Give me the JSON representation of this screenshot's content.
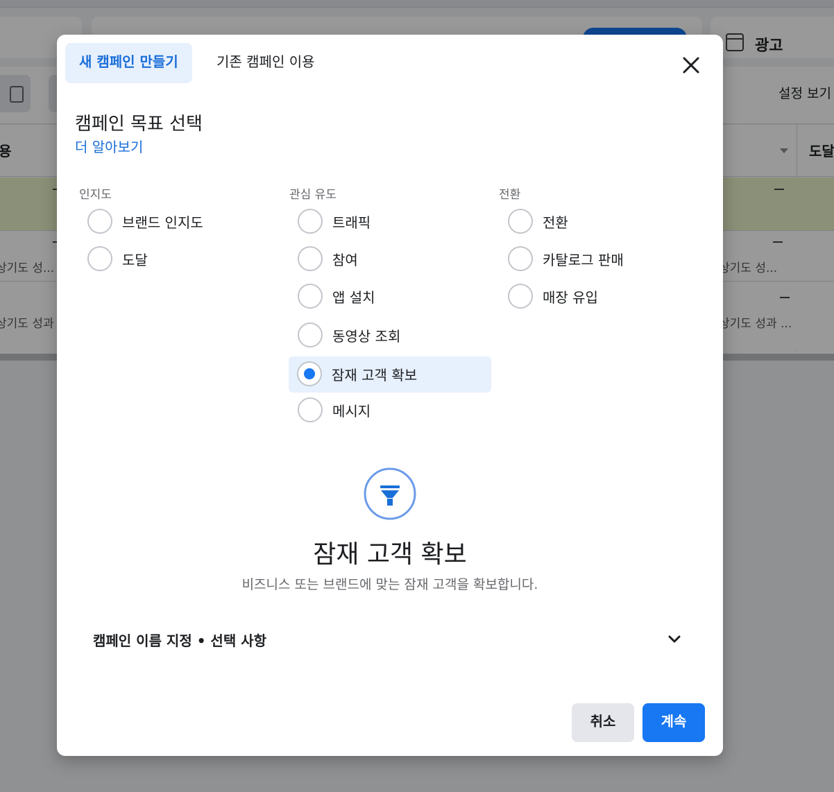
{
  "background": {
    "ad_label": "광고",
    "settings_label": "설정 보기",
    "col_header_left": "용",
    "col_header_right": "도달",
    "row2_left_text": "상기도 성...",
    "row3_left_text": "상기도 성과",
    "row2_right_text": "상기도 성...",
    "row3_right_text": "상기도 성과 ..."
  },
  "modal": {
    "tabs": [
      {
        "label": "새 캠페인 만들기",
        "active": true
      },
      {
        "label": "기존 캠페인 이용",
        "active": false
      }
    ],
    "close_icon": "close-icon",
    "section_title": "캠페인 목표 선택",
    "learn_more": "더 알아보기",
    "columns": [
      {
        "heading": "인지도",
        "options": [
          "브랜드 인지도",
          "도달"
        ]
      },
      {
        "heading": "관심 유도",
        "options": [
          "트래픽",
          "참여",
          "앱 설치",
          "동영상 조회",
          "잠재 고객 확보",
          "메시지"
        ]
      },
      {
        "heading": "전환",
        "options": [
          "전환",
          "카탈로그 판매",
          "매장 유입"
        ]
      }
    ],
    "selected_option": "잠재 고객 확보",
    "detail": {
      "icon": "funnel-icon",
      "title": "잠재 고객 확보",
      "description": "비즈니스 또는 브랜드에 맞는 잠재 고객을 확보합니다."
    },
    "naming_section": {
      "label": "캠페인 이름 지정 • 선택 사항",
      "icon": "chevron-down-icon"
    },
    "buttons": {
      "cancel": "취소",
      "continue": "계속"
    },
    "colors": {
      "accent": "#1877f2",
      "selected_bg": "#e7f0fd",
      "link": "#1a6ed8"
    }
  }
}
